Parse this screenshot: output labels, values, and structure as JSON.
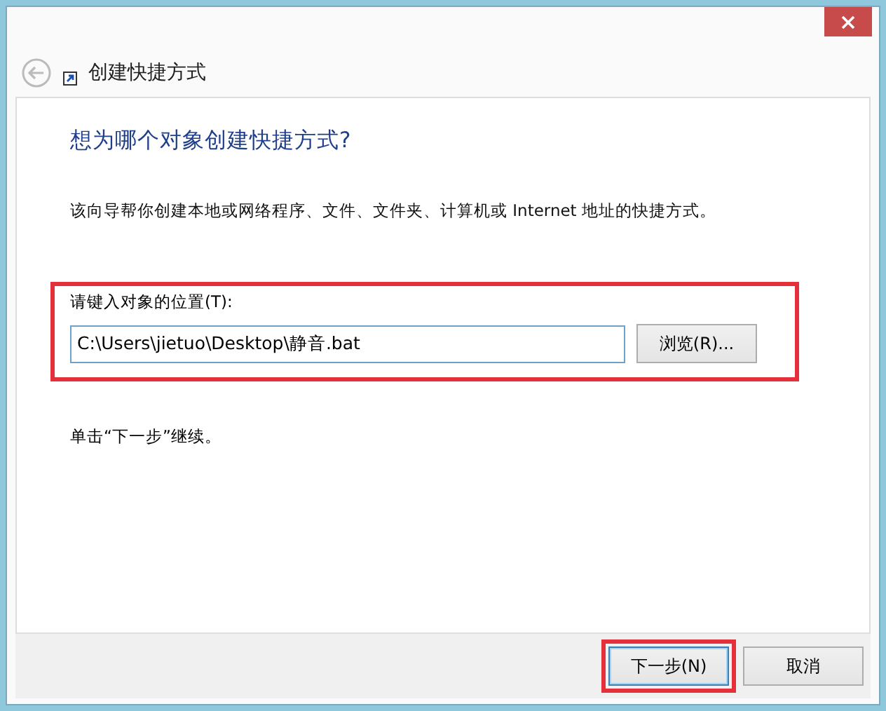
{
  "window": {
    "title": "创建快捷方式"
  },
  "heading": "想为哪个对象创建快捷方式?",
  "description": "该向导帮你创建本地或网络程序、文件、文件夹、计算机或 Internet 地址的快捷方式。",
  "location": {
    "label": "请键入对象的位置(T):",
    "value": "C:\\Users\\jietuo\\Desktop\\静音.bat",
    "browse_button": "浏览(R)...",
    "highlighted": true
  },
  "hint": "单击“下一步”继续。",
  "buttons": [
    {
      "label": "下一步(N)",
      "default": true,
      "highlighted": true
    },
    {
      "label": "取消",
      "default": false,
      "highlighted": false
    }
  ]
}
